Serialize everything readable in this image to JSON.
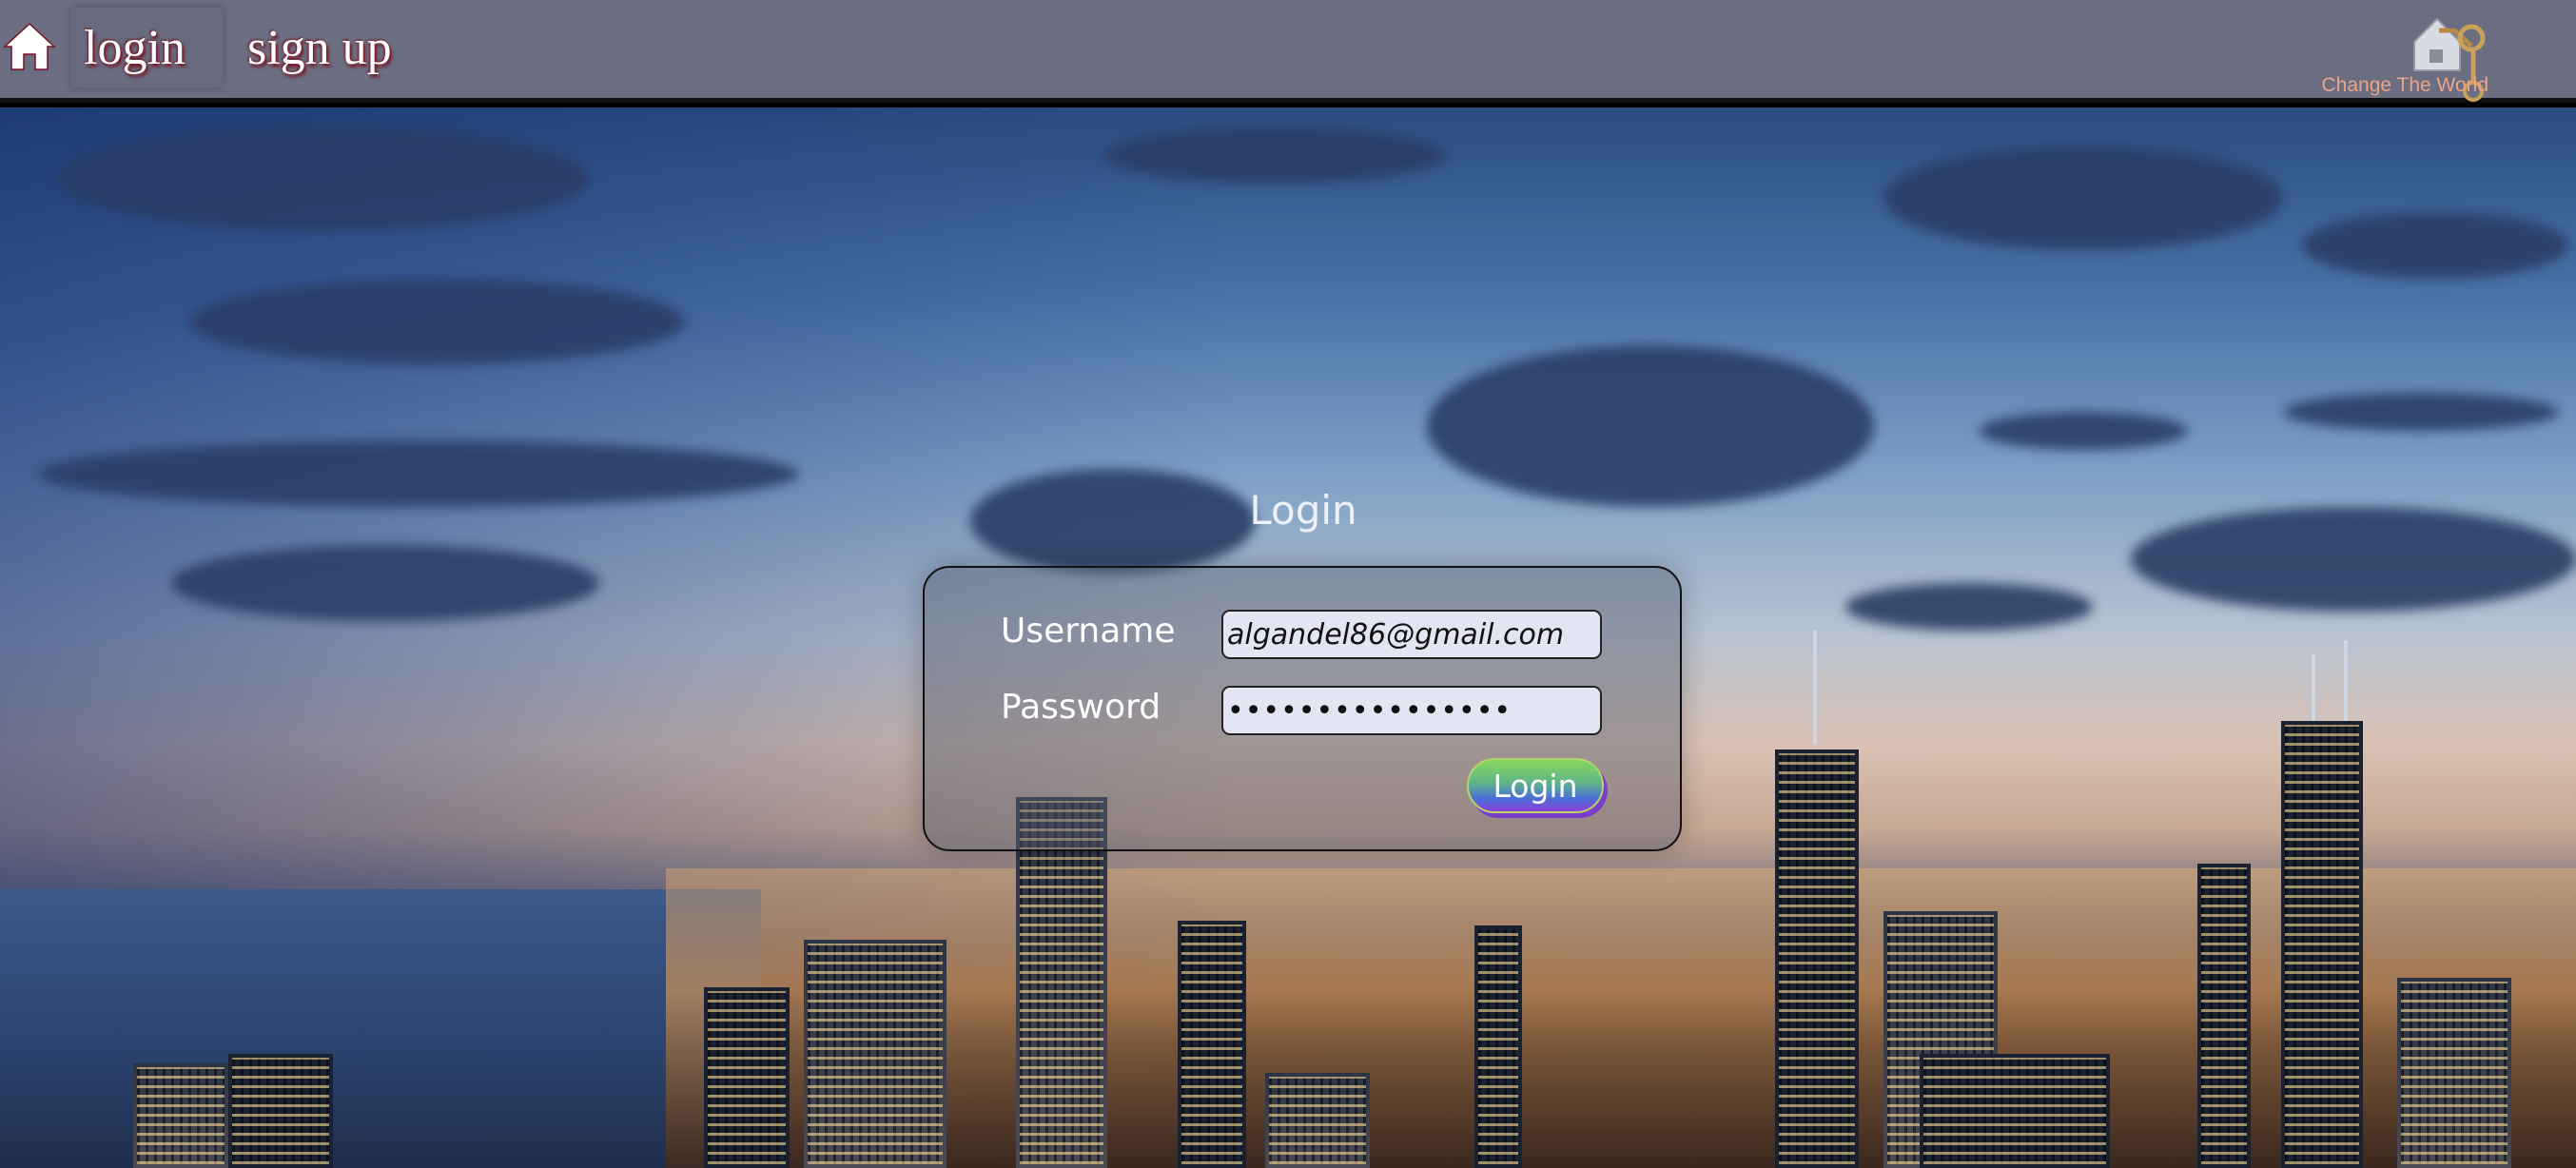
{
  "nav": {
    "home_icon": "home-icon",
    "links": [
      "login",
      "sign up"
    ],
    "brand_text": "Change The World"
  },
  "login": {
    "title": "Login",
    "username_label": "Username",
    "username_value": "algandel86@gmail.com",
    "password_label": "Password",
    "password_value": "••••••••••••••••",
    "submit_label": "Login"
  },
  "colors": {
    "navbar": "#6b6d80",
    "nav_text_shadow": "#7a0f22",
    "brand_text": "#e9a48b",
    "input_bg": "#e3e5f2"
  }
}
